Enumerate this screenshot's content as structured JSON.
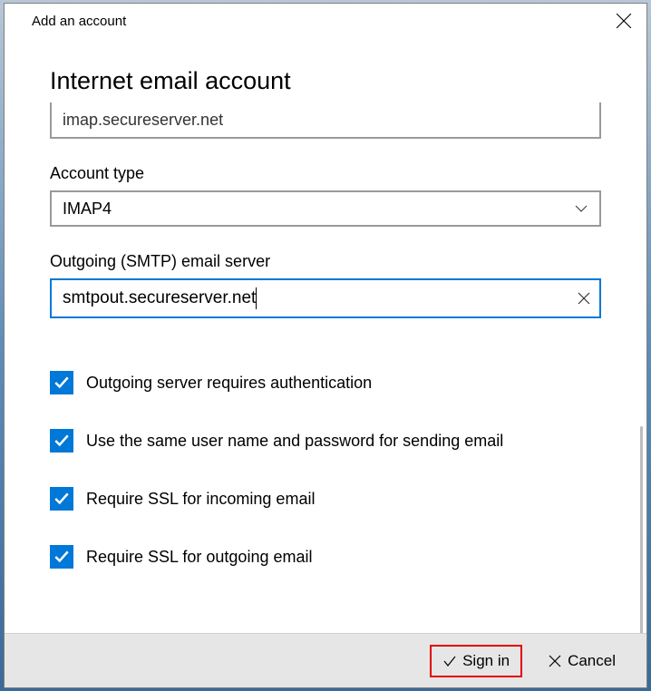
{
  "titlebar": {
    "title": "Add an account"
  },
  "heading": "Internet email account",
  "incoming": {
    "value": "imap.secureserver.net"
  },
  "account_type": {
    "label": "Account type",
    "value": "IMAP4"
  },
  "outgoing": {
    "label": "Outgoing (SMTP) email server",
    "value": "smtpout.secureserver.net"
  },
  "checks": {
    "auth": "Outgoing server requires authentication",
    "same": "Use the same user name and password for sending email",
    "ssl_in": "Require SSL for incoming email",
    "ssl_out": "Require SSL for outgoing email"
  },
  "footer": {
    "sign_in": "Sign in",
    "cancel": "Cancel"
  }
}
